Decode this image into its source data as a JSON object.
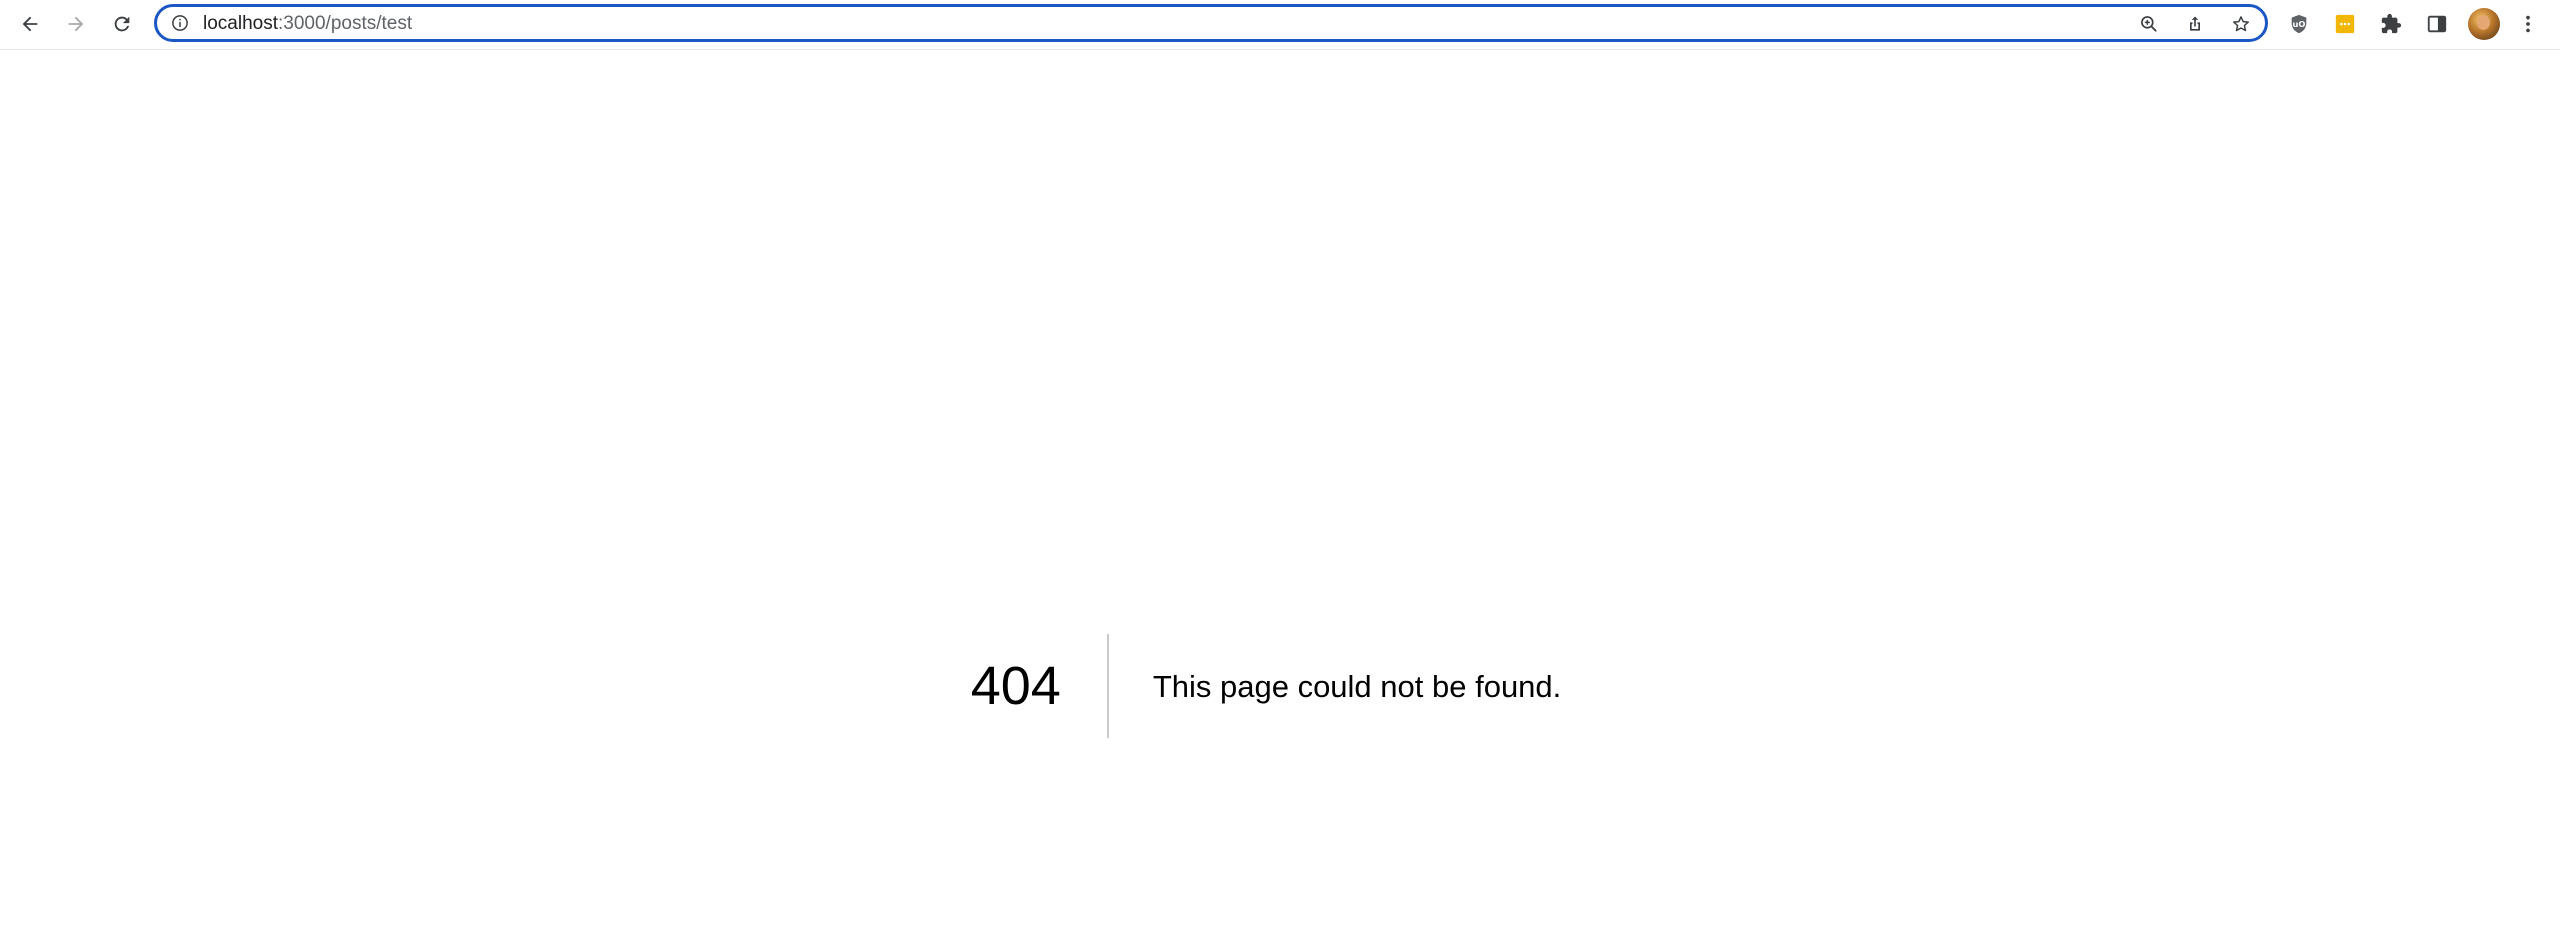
{
  "browser": {
    "address_bar": {
      "host": "localhost",
      "path": ":3000/posts/test"
    },
    "icons": {
      "back": "back-arrow-icon",
      "forward": "forward-arrow-icon",
      "reload": "reload-icon",
      "site_info": "info-icon",
      "zoom": "zoom-icon",
      "share": "share-icon",
      "bookmark": "star-icon",
      "extension_1": "shield-extension-icon",
      "extension_2": "password-manager-extension-icon",
      "extensions": "puzzle-icon",
      "side_panel": "side-panel-icon",
      "profile": "avatar",
      "menu": "kebab-menu-icon"
    },
    "accent_color": "#1a56c4"
  },
  "page": {
    "error_code": "404",
    "error_message": "This page could not be found."
  }
}
